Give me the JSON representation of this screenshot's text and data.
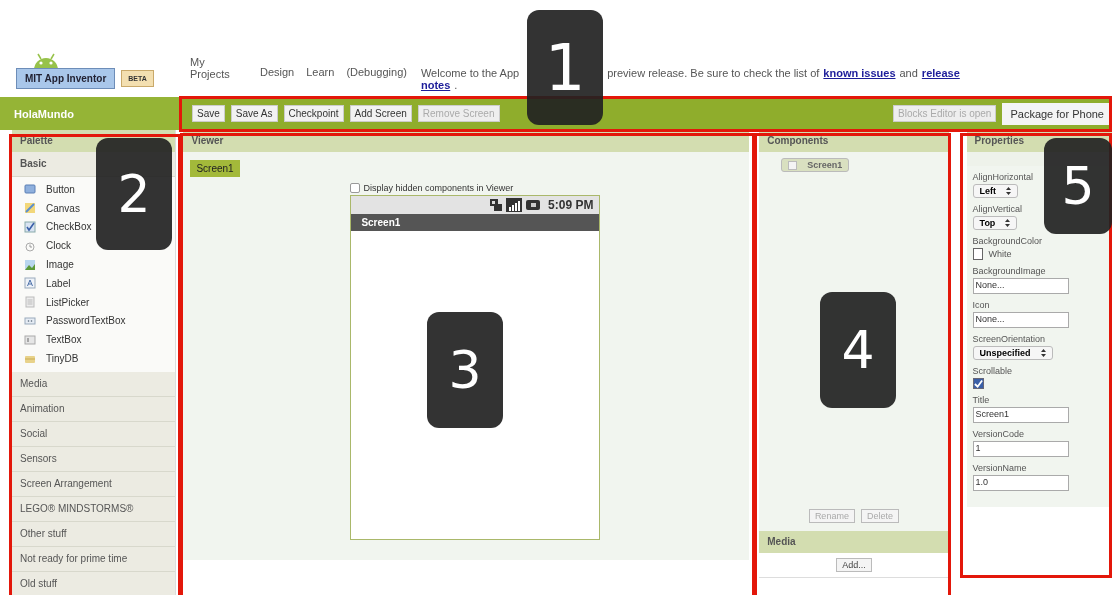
{
  "app": {
    "name": "MIT App Inventor",
    "badge": "BETA"
  },
  "nav": [
    {
      "label": "My Projects"
    },
    {
      "label": "Design"
    },
    {
      "label": "Learn"
    },
    {
      "label": "(Debugging)"
    }
  ],
  "welcome": {
    "lines": [
      [
        {
          "text": "Welcome to the App",
          "link": false
        },
        {
          "text": "preview release. Be sure to check the list of",
          "link": false
        },
        {
          "text": "known issues",
          "link": true
        },
        {
          "text": "and",
          "link": false
        },
        {
          "text": "release",
          "link": true
        }
      ],
      [
        {
          "text": "notes",
          "link": true
        },
        {
          "text": ".",
          "link": false
        }
      ]
    ]
  },
  "project": "HolaMundo",
  "toolbar": [
    {
      "label": "Save",
      "disabled": false
    },
    {
      "label": "Save As",
      "disabled": false
    },
    {
      "label": "Checkpoint",
      "disabled": false
    },
    {
      "label": "Add Screen",
      "disabled": false
    },
    {
      "label": "Remove Screen",
      "disabled": true
    }
  ],
  "toolbar_right": [
    {
      "label": "Blocks Editor is open",
      "disabled": true
    },
    {
      "label": "Package for Phone",
      "disabled": false
    }
  ],
  "palette": {
    "title": "Palette",
    "sections": [
      {
        "label": "Basic",
        "expanded": true,
        "items": [
          {
            "label": "Button",
            "kind": "button"
          },
          {
            "label": "Canvas",
            "kind": "canvas"
          },
          {
            "label": "CheckBox",
            "kind": "checkbox"
          },
          {
            "label": "Clock",
            "kind": "clock"
          },
          {
            "label": "Image",
            "kind": "image"
          },
          {
            "label": "Label",
            "kind": "label"
          },
          {
            "label": "ListPicker",
            "kind": "list"
          },
          {
            "label": "PasswordTextBox",
            "kind": "password"
          },
          {
            "label": "TextBox",
            "kind": "textbox"
          },
          {
            "label": "TinyDB",
            "kind": "database"
          }
        ]
      },
      {
        "label": "Media",
        "expanded": false
      },
      {
        "label": "Animation",
        "expanded": false
      },
      {
        "label": "Social",
        "expanded": false
      },
      {
        "label": "Sensors",
        "expanded": false
      },
      {
        "label": "Screen Arrangement",
        "expanded": false
      },
      {
        "label": "LEGO® MINDSTORMS®",
        "expanded": false
      },
      {
        "label": "Other stuff",
        "expanded": false
      },
      {
        "label": "Not ready for prime time",
        "expanded": false
      },
      {
        "label": "Old stuff",
        "expanded": false
      }
    ]
  },
  "viewer": {
    "title": "Viewer",
    "screen_button": "Screen1",
    "hidden_toggle": {
      "label": "Display hidden components in Viewer",
      "checked": false
    },
    "phone": {
      "time": "5:09 PM",
      "title": "Screen1"
    }
  },
  "components": {
    "title": "Components",
    "tree": [
      {
        "label": "Screen1",
        "selected": true
      }
    ],
    "buttons": [
      {
        "label": "Rename",
        "disabled": true
      },
      {
        "label": "Delete",
        "disabled": true
      }
    ]
  },
  "media": {
    "title": "Media",
    "button": "Add..."
  },
  "properties": {
    "title": "Properties",
    "items": [
      {
        "label": "AlignHorizontal",
        "kind": "select",
        "value": "Left"
      },
      {
        "label": "AlignVertical",
        "kind": "select",
        "value": "Top"
      },
      {
        "label": "BackgroundColor",
        "kind": "color",
        "value": "White",
        "color": "#ffffff"
      },
      {
        "label": "BackgroundImage",
        "kind": "text",
        "value": "None..."
      },
      {
        "label": "Icon",
        "kind": "text",
        "value": "None..."
      },
      {
        "label": "ScreenOrientation",
        "kind": "select",
        "value": "Unspecified"
      },
      {
        "label": "Scrollable",
        "kind": "checkbox",
        "checked": true
      },
      {
        "label": "Title",
        "kind": "text",
        "value": "Screen1"
      },
      {
        "label": "VersionCode",
        "kind": "text",
        "value": "1"
      },
      {
        "label": "VersionName",
        "kind": "text",
        "value": "1.0"
      }
    ]
  },
  "annotations": [
    {
      "label": "1"
    },
    {
      "label": "2"
    },
    {
      "label": "3"
    },
    {
      "label": "4"
    },
    {
      "label": "5"
    }
  ]
}
